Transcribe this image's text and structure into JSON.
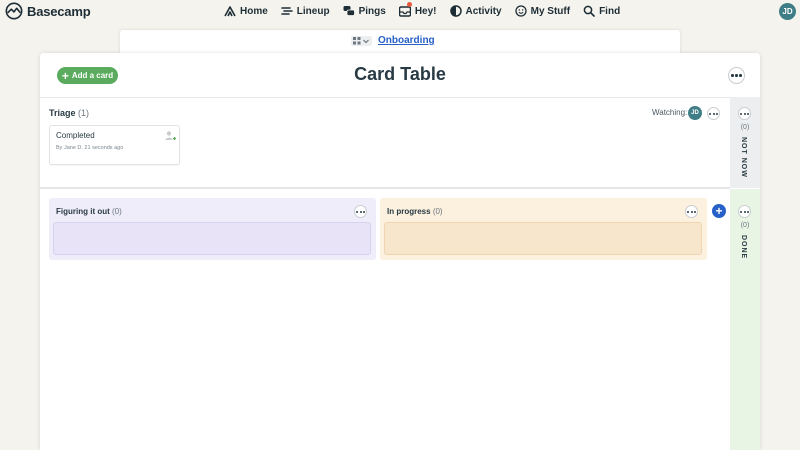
{
  "app": {
    "name": "Basecamp"
  },
  "nav": {
    "items": [
      {
        "label": "Home",
        "icon": "home-icon"
      },
      {
        "label": "Lineup",
        "icon": "lineup-icon"
      },
      {
        "label": "Pings",
        "icon": "pings-icon"
      },
      {
        "label": "Hey!",
        "icon": "hey-icon"
      },
      {
        "label": "Activity",
        "icon": "activity-icon"
      },
      {
        "label": "My Stuff",
        "icon": "smiley-icon"
      },
      {
        "label": "Find",
        "icon": "search-icon"
      }
    ],
    "avatar_initials": "JD"
  },
  "breadcrumb": {
    "project": "Onboarding"
  },
  "header": {
    "title": "Card Table",
    "add_card_label": "Add a card"
  },
  "triage": {
    "title": "Triage",
    "count": "(1)",
    "watching_label": "Watching:",
    "watcher_initials": "JD",
    "cards": [
      {
        "title": "Completed",
        "meta": "By Jane D. 21 seconds ago"
      }
    ]
  },
  "columns": [
    {
      "title": "Figuring it out",
      "count": "(0)",
      "color": "#f0edfa"
    },
    {
      "title": "In progress",
      "count": "(0)",
      "color": "#fcf0df"
    }
  ],
  "rail": {
    "not_now": {
      "label": "NOT NOW",
      "count": "(0)"
    },
    "done": {
      "label": "DONE",
      "count": "(0)"
    }
  },
  "colors": {
    "accent_green": "#5aab5e",
    "link_blue": "#2660c8",
    "avatar": "#3f7e86"
  }
}
